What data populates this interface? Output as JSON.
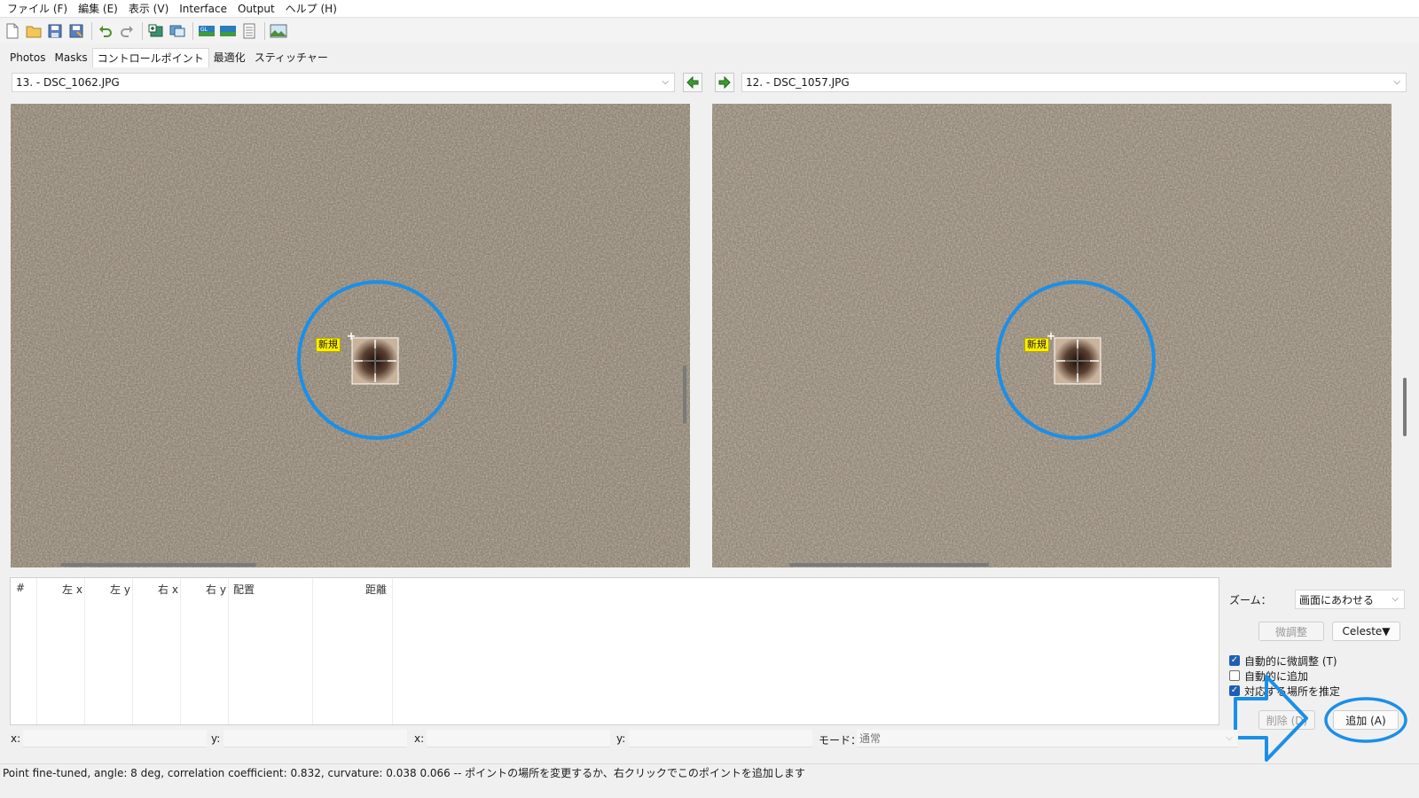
{
  "menu": [
    "ファイル (F)",
    "編集 (E)",
    "表示 (V)",
    "Interface",
    "Output",
    "ヘルプ (H)"
  ],
  "tabs": [
    {
      "label": "Photos",
      "active": false
    },
    {
      "label": "Masks",
      "active": false
    },
    {
      "label": "コントロールポイント",
      "active": true
    },
    {
      "label": "最適化",
      "active": false
    },
    {
      "label": "スティッチャー",
      "active": false
    }
  ],
  "left_image": {
    "selected": "13. - DSC_1062.JPG",
    "point_label": "新規"
  },
  "right_image": {
    "selected": "12. - DSC_1057.JPG",
    "point_label": "新規"
  },
  "table": {
    "headers": [
      "#",
      "左 x",
      "左 y",
      "右 x",
      "右 y",
      "配置",
      "距離"
    ],
    "rows": []
  },
  "controls": {
    "zoom_label": "ズーム：",
    "zoom_value": "画面にあわせる",
    "fine_tune": "微調整",
    "celeste": "Celeste▼",
    "auto_fine_tune": {
      "label": "自動的に微調整 (T)",
      "checked": true
    },
    "auto_add": {
      "label": "自動的に追加",
      "checked": false
    },
    "estimate": {
      "label": "対応する場所を推定",
      "checked": true
    },
    "delete": "削除 (D)",
    "add": "追加 (A)"
  },
  "coords": {
    "x1_label": "x:",
    "y1_label": "y:",
    "x2_label": "x:",
    "y2_label": "y:",
    "mode_label": "モード：",
    "mode_value": "通常"
  },
  "status": "Point fine-tuned, angle: 8 deg, correlation coefficient: 0.832, curvature: 0.038 0.066 -- ポイントの場所を変更するか、右クリックでこのポイントを追加します",
  "colors": {
    "highlight": "#1b8fe8",
    "point_label_bg": "#ffef00",
    "checkbox": "#1e5fb4"
  }
}
